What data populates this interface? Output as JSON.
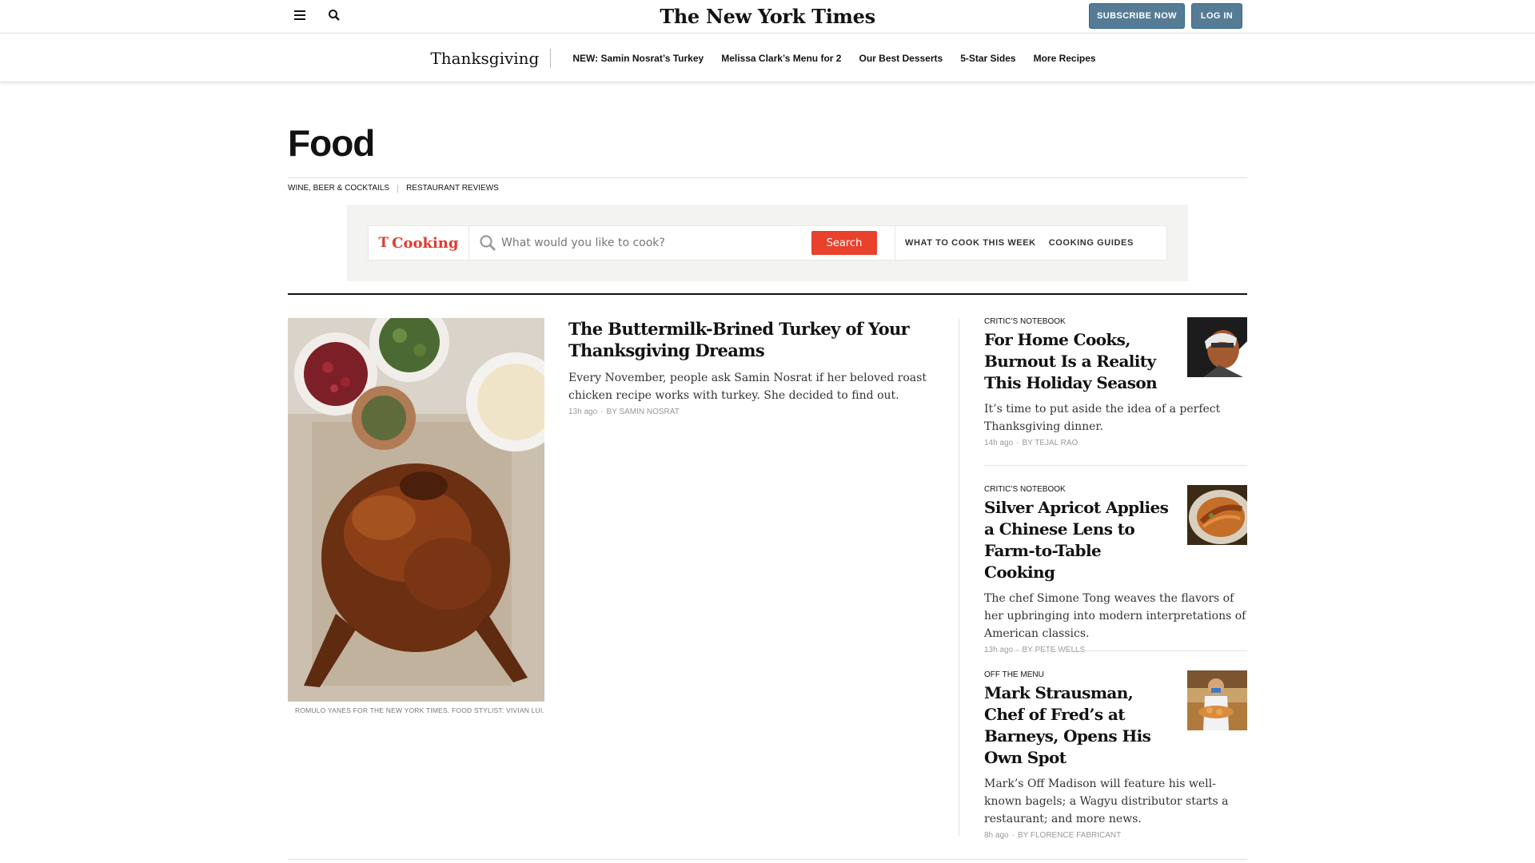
{
  "masthead": {
    "logo": "The New York Times",
    "subscribe_label": "SUBSCRIBE NOW",
    "login_label": "LOG IN",
    "menu_icon": "hamburger-menu-icon",
    "search_icon": "search-icon"
  },
  "thanksgiving_nav": {
    "title": "Thanksgiving",
    "links": [
      "NEW: Samin Nosrat’s Turkey",
      "Melissa Clark’s Menu for 2",
      "Our Best Desserts",
      "5-Star Sides",
      "More Recipes"
    ]
  },
  "section": {
    "title": "Food",
    "subnav": [
      "WINE, BEER & COCKTAILS",
      "RESTAURANT REVIEWS"
    ]
  },
  "cooking": {
    "logo_text": "Cooking",
    "logo_t": "T",
    "placeholder": "What would you like to cook?",
    "search_label": "Search",
    "links": [
      "WHAT TO COOK THIS WEEK",
      "COOKING GUIDES"
    ],
    "accent": "#e8412c"
  },
  "lead": {
    "headline": "The Buttermilk-Brined Turkey of Your Thanksgiving Dreams",
    "summary": "Every November, people ask Samin Nosrat if her beloved roast chicken recipe works with turkey. She decided to find out.",
    "time": "13h ago",
    "byline": "By SAMIN NOSRAT",
    "credit": "ROMULO YANES FOR THE NEW YORK TIMES. FOOD STYLIST: VIVIAN LUI."
  },
  "rail": [
    {
      "kicker": "CRITIC’S NOTEBOOK",
      "headline": "For Home Cooks, Burnout Is a Reality This Holiday Season",
      "summary": "It’s time to put aside the idea of a perfect Thanksgiving dinner.",
      "time": "14h ago",
      "byline": "By TEJAL RAO"
    },
    {
      "kicker": "CRITIC’S NOTEBOOK",
      "headline": "Silver Apricot Applies a Chinese Lens to Farm-to-Table Cooking",
      "summary": "The chef Simone Tong weaves the flavors of her upbringing into modern interpretations of American classics.",
      "time": "13h ago",
      "byline": "By PETE WELLS"
    },
    {
      "kicker": "OFF THE MENU",
      "headline": "Mark Strausman, Chef of Fred’s at Barneys, Opens His Own Spot",
      "summary": "Mark’s Off Madison will feature his well-known bagels; a Wagyu distributor starts a restaurant; and more news.",
      "time": "8h ago",
      "byline": "By FLORENCE FABRICANT"
    }
  ],
  "colors": {
    "brand_button": "#567b95",
    "text": "#121212",
    "meta": "#999999"
  }
}
